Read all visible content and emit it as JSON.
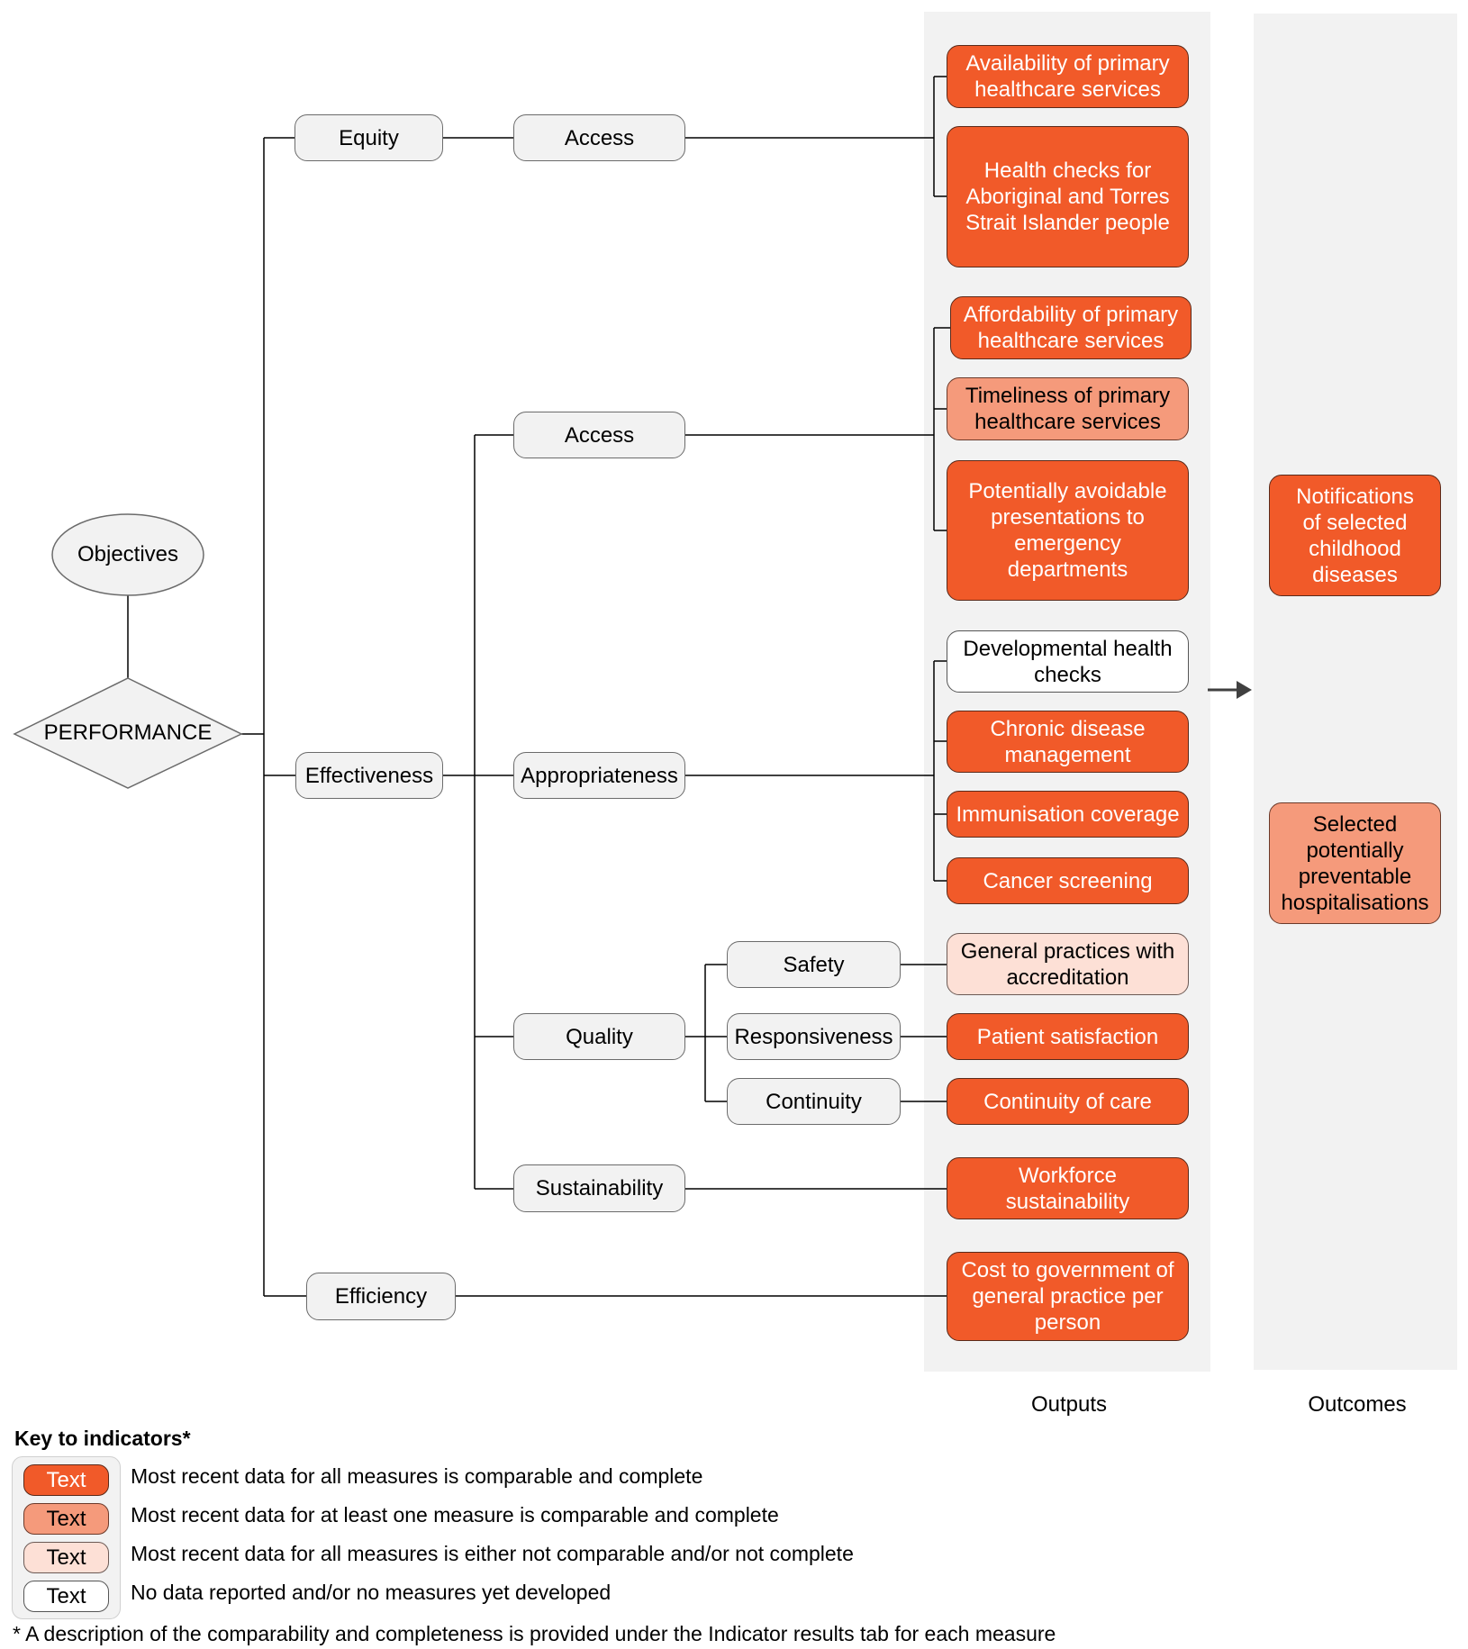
{
  "diagram": {
    "objectives_label": "Objectives",
    "performance_label": "PERFORMANCE",
    "level1": {
      "equity": "Equity",
      "effectiveness": "Effectiveness",
      "efficiency": "Efficiency"
    },
    "level2": {
      "equity_access": "Access",
      "effectiveness_access": "Access",
      "appropriateness": "Appropriateness",
      "quality": "Quality",
      "sustainability": "Sustainability"
    },
    "level3": {
      "safety": "Safety",
      "responsiveness": "Responsiveness",
      "continuity": "Continuity"
    },
    "outputs": [
      {
        "label": "Availability of primary healthcare services",
        "status": "full"
      },
      {
        "label": "Health checks for Aboriginal and Torres Strait Islander people",
        "status": "full"
      },
      {
        "label": "Affordability of primary healthcare services",
        "status": "full"
      },
      {
        "label": "Timeliness of primary healthcare services",
        "status": "partial"
      },
      {
        "label": "Potentially avoidable presentations to emergency departments",
        "status": "full"
      },
      {
        "label": "Developmental health checks",
        "status": "nodata"
      },
      {
        "label": "Chronic disease management",
        "status": "full"
      },
      {
        "label": "Immunisation coverage",
        "status": "full"
      },
      {
        "label": "Cancer screening",
        "status": "full"
      },
      {
        "label": "General practices with accreditation",
        "status": "none"
      },
      {
        "label": "Patient satisfaction",
        "status": "full"
      },
      {
        "label": "Continuity of care",
        "status": "full"
      },
      {
        "label": "Workforce sustainability",
        "status": "full"
      },
      {
        "label": "Cost to government of general practice per person",
        "status": "full"
      }
    ],
    "outcomes": [
      {
        "label": "Notifications of selected childhood diseases",
        "status": "full"
      },
      {
        "label": "Selected potentially preventable hospitalisations",
        "status": "partial"
      }
    ],
    "outputs_column_label": "Outputs",
    "outcomes_column_label": "Outcomes",
    "arrow_icon": "right-arrow"
  },
  "key": {
    "title": "Key to indicators*",
    "items": [
      {
        "swatch_text": "Text",
        "description": "Most recent data for all measures is comparable and complete",
        "color": "#f15a29"
      },
      {
        "swatch_text": "Text",
        "description": "Most recent data for at least one measure is comparable and complete",
        "color": "#f59a7b"
      },
      {
        "swatch_text": "Text",
        "description": "Most recent data for all measures is either not comparable and/or not complete",
        "color": "#fde0d6"
      },
      {
        "swatch_text": "Text",
        "description": "No data reported and/or no measures yet developed",
        "color": "#ffffff"
      }
    ],
    "footnote": "* A description of the comparability and completeness is provided under the Indicator results tab for each measure"
  }
}
